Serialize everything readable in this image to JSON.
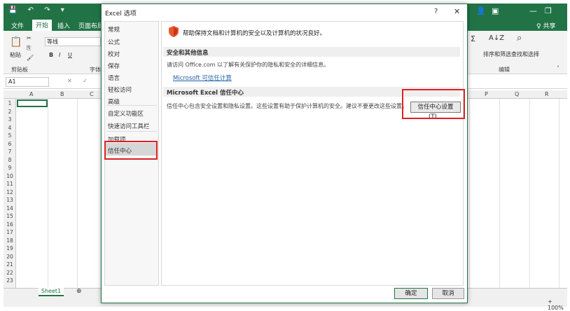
{
  "excel": {
    "tabs": [
      "文件",
      "开始",
      "插入",
      "页面布局"
    ],
    "active_tab": "开始",
    "share": "♀ 共享",
    "paste_label": "粘贴",
    "clipboard_group": "剪贴板",
    "font_name": "等线",
    "font_group": "字体",
    "bold": "B",
    "italic": "I",
    "underline": "U",
    "sort_filter": "排序和筛选",
    "find_select": "查找和选择",
    "editing_group": "编辑",
    "name_box": "A1",
    "columns_left": [
      "A",
      "B",
      "C"
    ],
    "columns_right": [
      "P",
      "Q",
      "R"
    ],
    "rows": [
      "1",
      "2",
      "3",
      "4",
      "5",
      "6",
      "7",
      "8",
      "9",
      "10",
      "11",
      "12",
      "13",
      "14",
      "15",
      "16",
      "17",
      "18",
      "19",
      "20",
      "21",
      "22",
      "23"
    ],
    "sheet_tab": "Sheet1",
    "zoom": "+ 100%"
  },
  "dialog": {
    "title": "Excel 选项",
    "help": "?",
    "close": "✕",
    "nav_items": [
      "常规",
      "公式",
      "校对",
      "保存",
      "语言",
      "轻松访问",
      "高级",
      "自定义功能区",
      "快速访问工具栏",
      "加载项",
      "信任中心"
    ],
    "selected_nav": "信任中心",
    "headline": "帮助保持文档和计算机的安全以及计算机的状况良好。",
    "section1_title": "安全和其他信息",
    "section1_body": "请访问 Office.com 以了解有关保护你的隐私和安全的详细信息。",
    "privacy_link": "Microsoft 可信任计算",
    "section2_title": "Microsoft Excel 信任中心",
    "section2_body": "信任中心包含安全设置和隐私设置。这些设置有助于保护计算机的安全。建议不要更改这些设置。",
    "trust_center_button": "信任中心设置(T)...",
    "ok": "确定",
    "cancel": "取消"
  },
  "colors": {
    "excel_green": "#217346",
    "highlight_red": "#e02020",
    "link_blue": "#1f5fa8"
  }
}
